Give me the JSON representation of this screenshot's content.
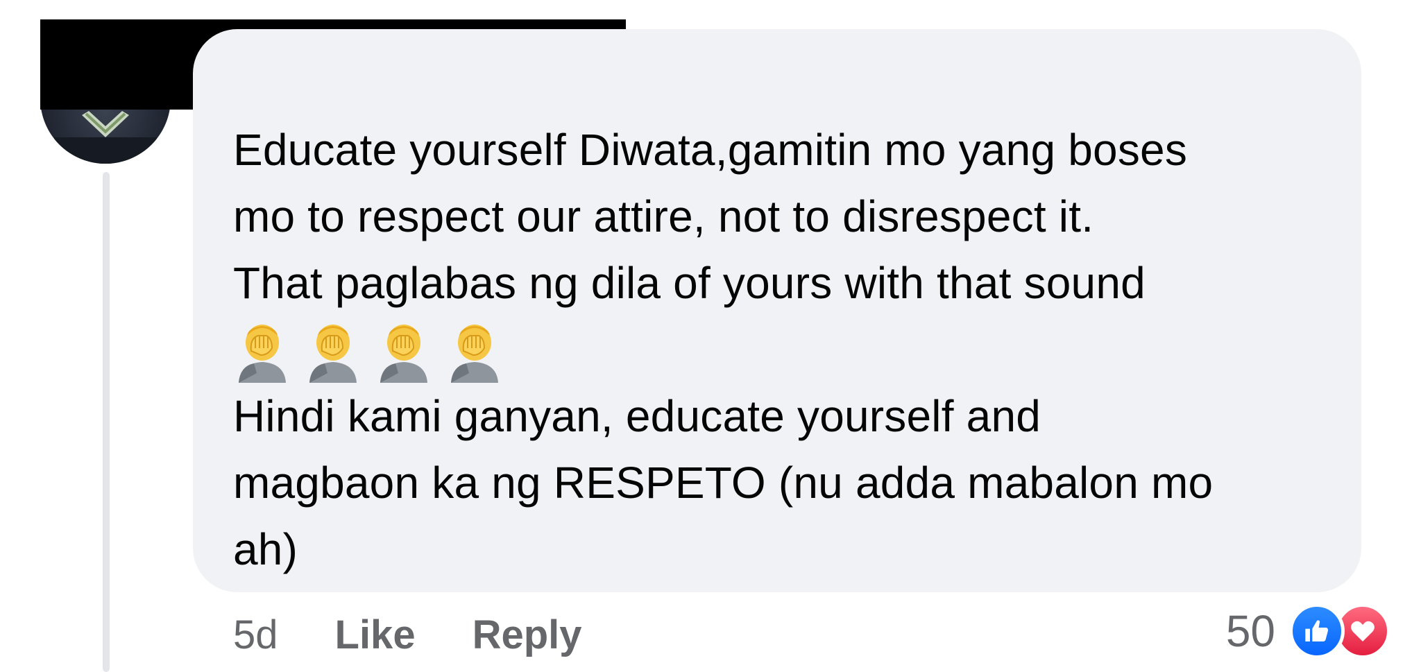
{
  "comment": {
    "lines": [
      "Educate yourself Diwata,gamitin mo yang boses",
      "mo to respect our attire, not to disrespect it.",
      "That paglabas ng dila of yours with that sound",
      "Hindi kami ganyan, educate yourself and",
      "magbaon ka ng RESPETO (nu adda mabalon mo",
      "ah)"
    ],
    "emoji": [
      "face-palm-emoji",
      "face-palm-emoji",
      "face-palm-emoji",
      "face-palm-emoji"
    ]
  },
  "actions": {
    "timestamp": "5d",
    "like_label": "Like",
    "reply_label": "Reply"
  },
  "reactions": {
    "count": "50",
    "icons": [
      "like-reaction-icon",
      "love-reaction-icon"
    ]
  },
  "colors": {
    "bubble": "#f0f2f5",
    "text": "#050505",
    "secondary_text": "#65676b",
    "like_blue": "#0866ff",
    "love_red": "#e41e3f"
  }
}
